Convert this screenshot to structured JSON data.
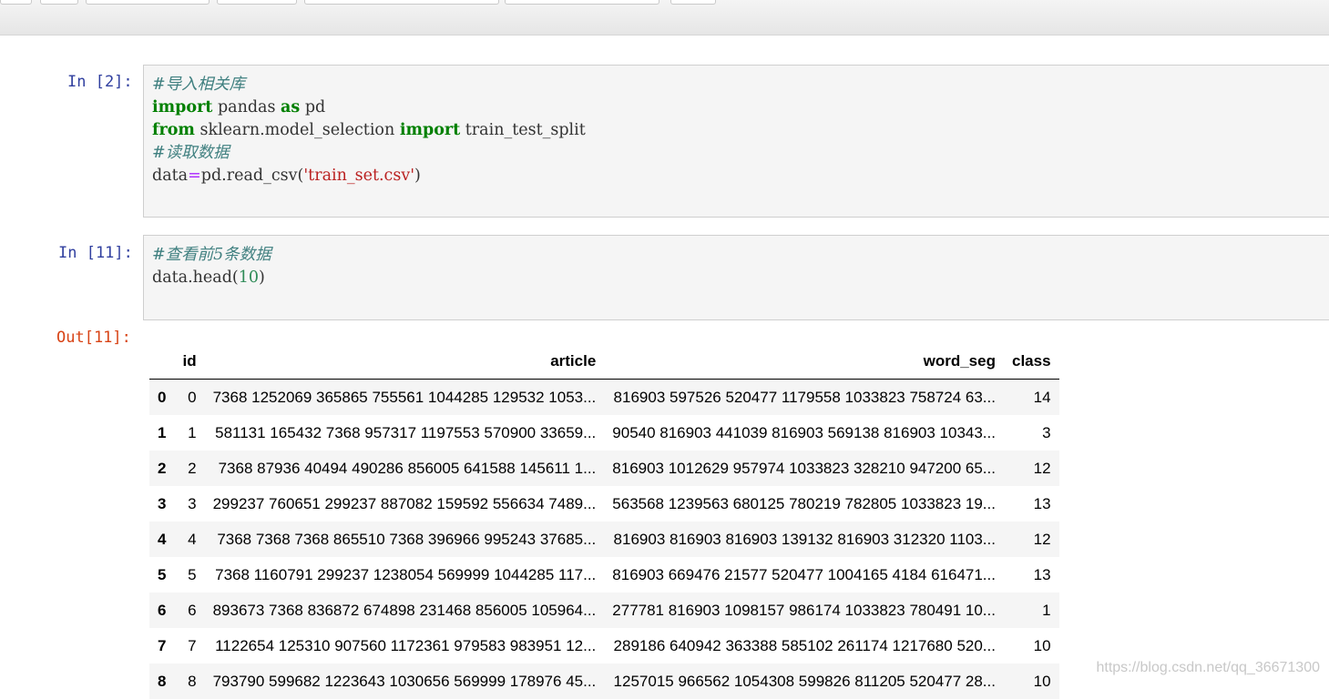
{
  "cells": [
    {
      "prompt": "In [2]:",
      "lines": [
        "#导入相关库",
        "import pandas as pd",
        "from sklearn.model_selection import train_test_split",
        "#读取数据",
        "data=pd.read_csv('train_set.csv')"
      ]
    },
    {
      "prompt": "In [11]:",
      "lines": [
        "#查看前5条数据",
        "data.head(10)"
      ]
    }
  ],
  "output": {
    "prompt": "Out[11]:",
    "columns": [
      "",
      "id",
      "article",
      "word_seg",
      "class"
    ],
    "rows": [
      [
        "0",
        "0",
        "7368 1252069 365865 755561 1044285 129532 1053...",
        "816903 597526 520477 1179558 1033823 758724 63...",
        "14"
      ],
      [
        "1",
        "1",
        "581131 165432 7368 957317 1197553 570900 33659...",
        "90540 816903 441039 816903 569138 816903 10343...",
        "3"
      ],
      [
        "2",
        "2",
        "7368 87936 40494 490286 856005 641588 145611 1...",
        "816903 1012629 957974 1033823 328210 947200 65...",
        "12"
      ],
      [
        "3",
        "3",
        "299237 760651 299237 887082 159592 556634 7489...",
        "563568 1239563 680125 780219 782805 1033823 19...",
        "13"
      ],
      [
        "4",
        "4",
        "7368 7368 7368 865510 7368 396966 995243 37685...",
        "816903 816903 816903 139132 816903 312320 1103...",
        "12"
      ],
      [
        "5",
        "5",
        "7368 1160791 299237 1238054 569999 1044285 117...",
        "816903 669476 21577 520477 1004165 4184 616471...",
        "13"
      ],
      [
        "6",
        "6",
        "893673 7368 836872 674898 231468 856005 105964...",
        "277781 816903 1098157 986174 1033823 780491 10...",
        "1"
      ],
      [
        "7",
        "7",
        "1122654 125310 907560 1172361 979583 983951 12...",
        "289186 640942 363388 585102 261174 1217680 520...",
        "10"
      ],
      [
        "8",
        "8",
        "793790 599682 1223643 1030656 569999 178976 45...",
        "1257015 966562 1054308 599826 811205 520477 28...",
        "10"
      ]
    ]
  },
  "watermark": "https://blog.csdn.net/qq_36671300"
}
